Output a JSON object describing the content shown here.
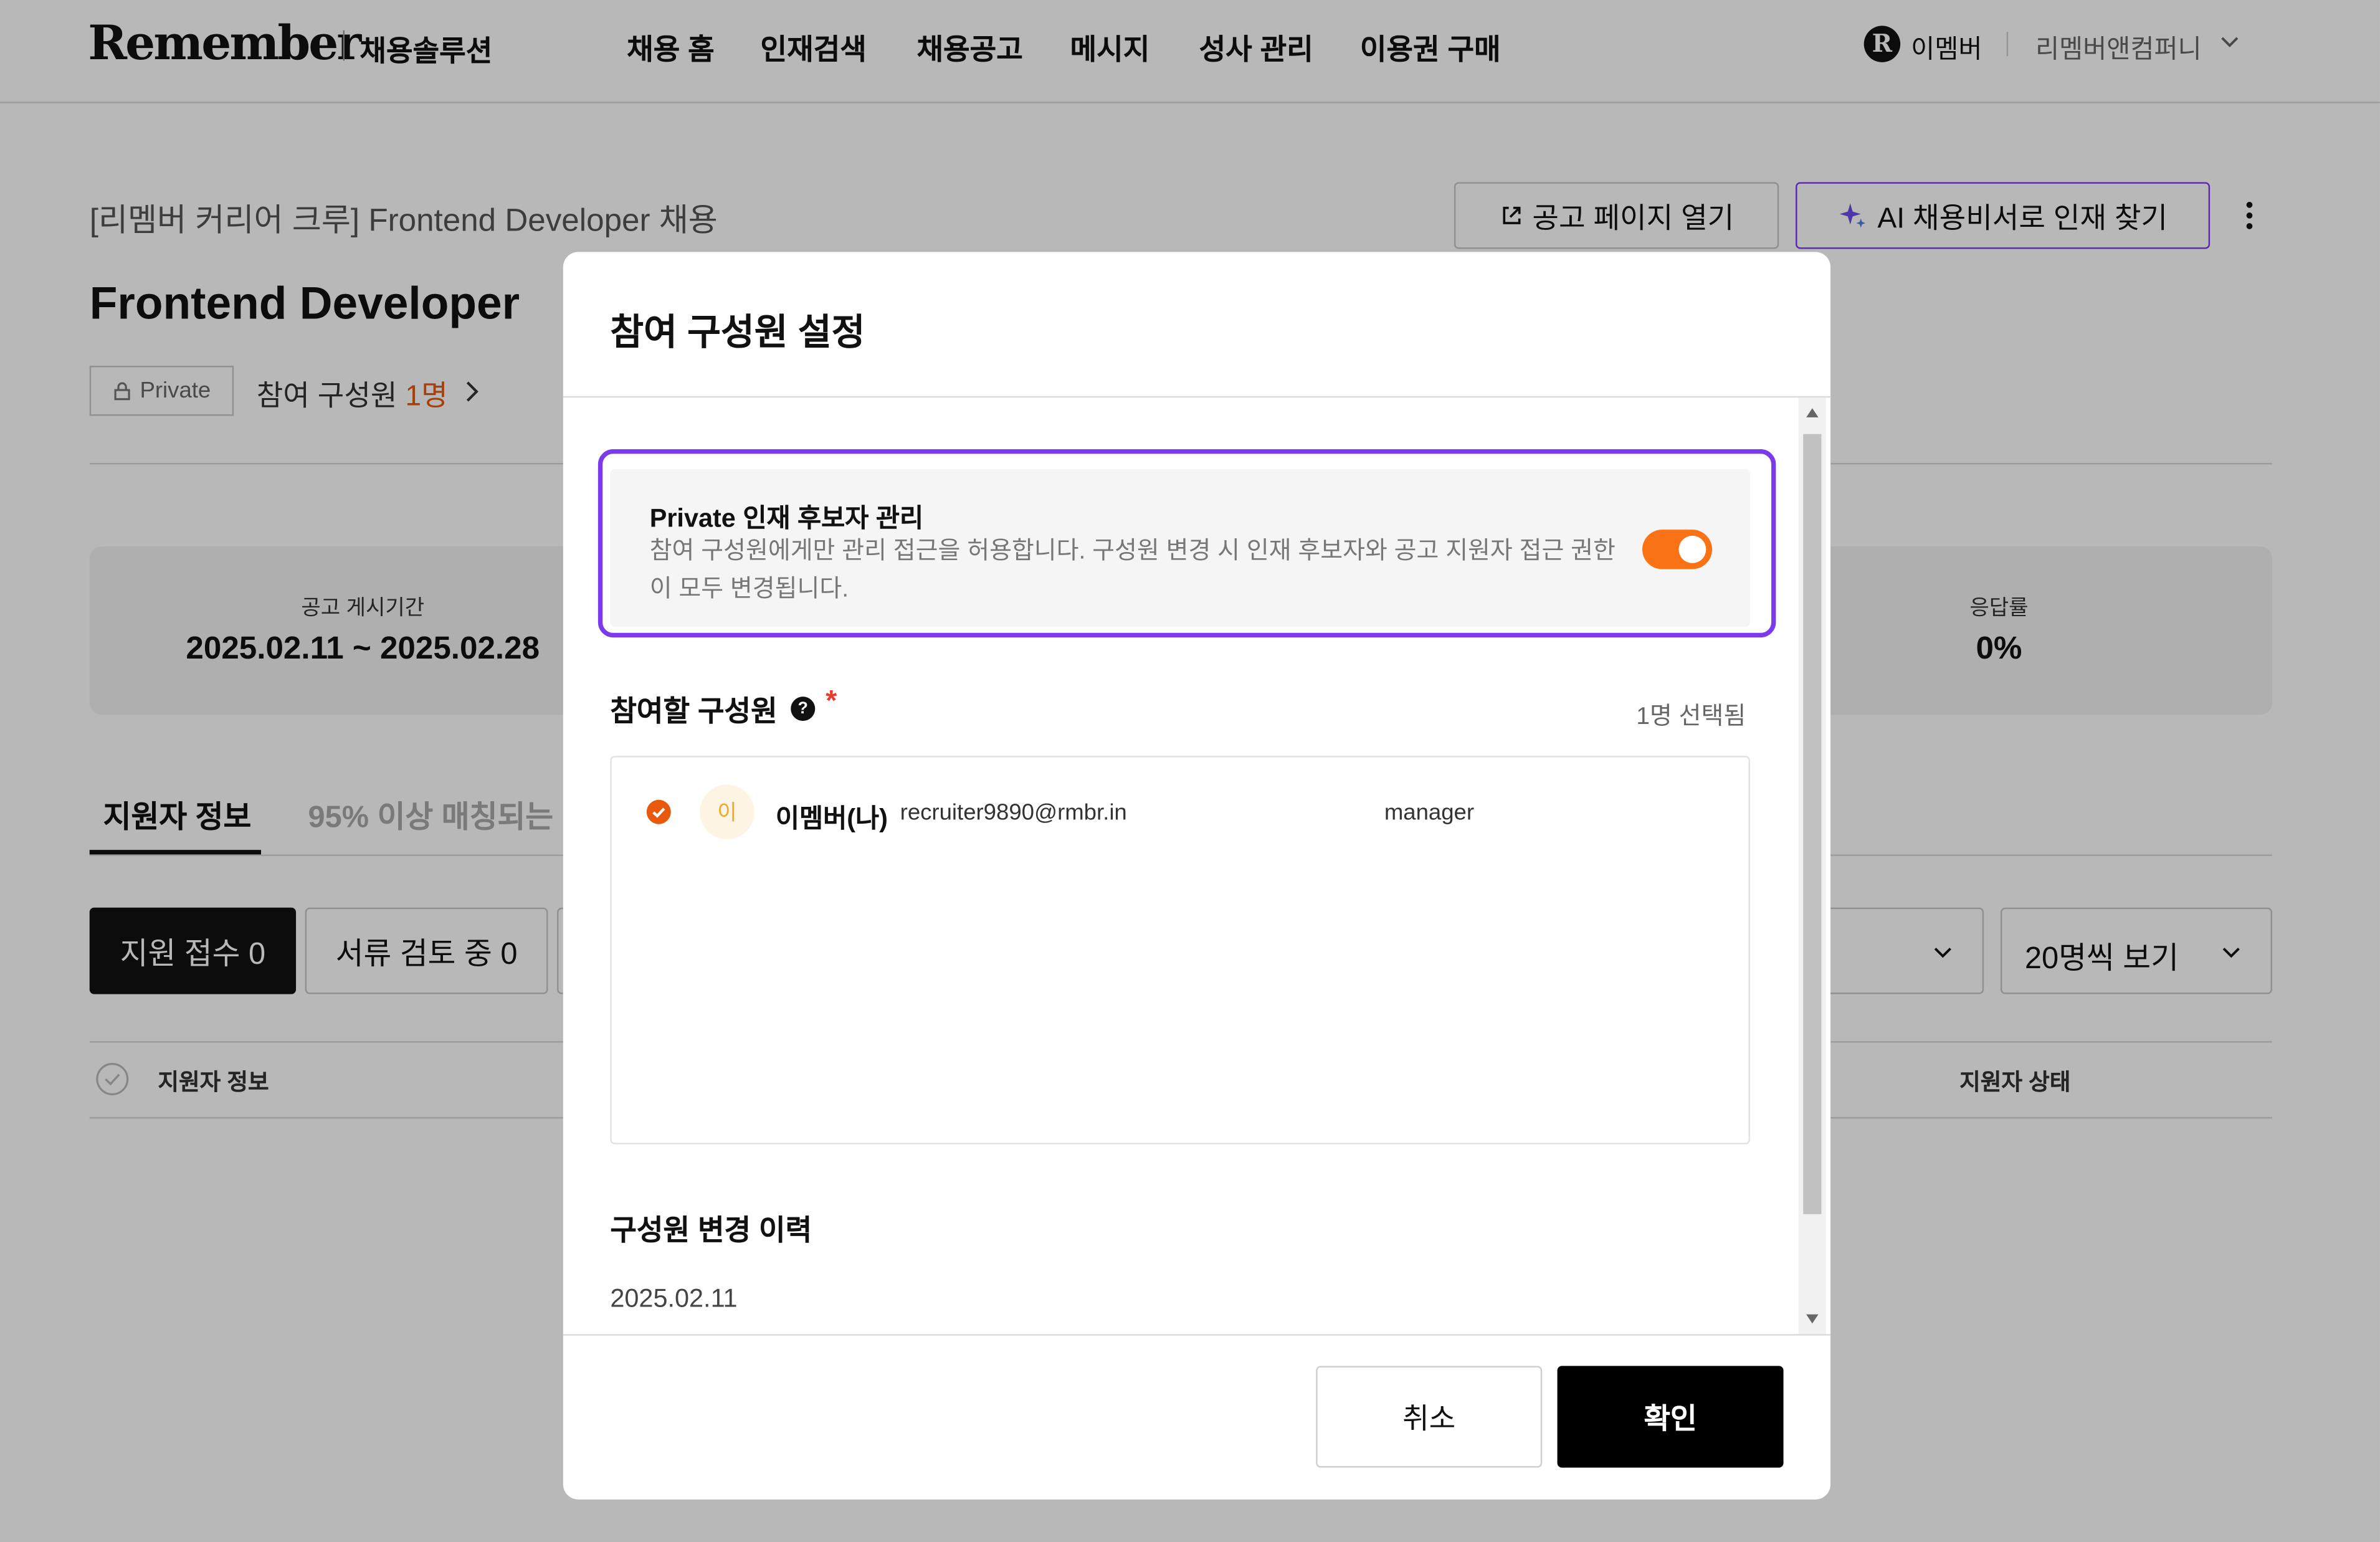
{
  "header": {
    "logo": "Remember",
    "logo_sub": "채용솔루션",
    "nav": [
      "채용 홈",
      "인재검색",
      "채용공고",
      "메시지",
      "성사 관리",
      "이용권 구매"
    ],
    "user_badge": "R",
    "user_name": "이멤버",
    "company": "리멤버앤컴퍼니"
  },
  "page": {
    "breadcrumb": "[리멤버 커리어 크루] Frontend Developer 채용",
    "open_posting_label": "공고 페이지 열기",
    "ai_button_label": "AI 채용비서로 인재 찾기",
    "job_title": "Frontend Developer",
    "private_tag": "Private",
    "members_label": "참여 구성원",
    "members_count": "1명",
    "stats": {
      "period_label": "공고 게시기간",
      "period_value": "2025.02.11 ~ 2025.02.28",
      "response_label": "응답률",
      "response_value": "0%"
    },
    "tabs": [
      "지원자 정보",
      "95% 이상 매칭되는 ·"
    ],
    "filters": [
      "지원 접수 0",
      "서류 검토 중 0"
    ],
    "page_size": "20명씩 보기",
    "table_headers": {
      "applicant": "지원자 정보",
      "status": "지원자 상태"
    }
  },
  "modal": {
    "title": "참여 구성원 설정",
    "private_title": "Private 인재 후보자 관리",
    "private_desc": "참여 구성원에게만 관리 접근을 허용합니다. 구성원 변경 시 인재 후보자와 공고 지원자 접근 권한이 모두 변경됩니다.",
    "private_enabled": true,
    "members_section": "참여할 구성원",
    "help_glyph": "?",
    "required_mark": "*",
    "selected_count": "1명 선택됨",
    "members": [
      {
        "avatar": "이",
        "name": "이멤버(나)",
        "email": "recruiter9890@rmbr.in",
        "role": "manager"
      }
    ],
    "history_label": "구성원 변경 이력",
    "history_date": "2025.02.11",
    "cancel_label": "취소",
    "confirm_label": "확인"
  },
  "colors": {
    "accent_orange": "#f97316",
    "highlight_purple": "#7c3aed",
    "primary_black": "#000000"
  }
}
